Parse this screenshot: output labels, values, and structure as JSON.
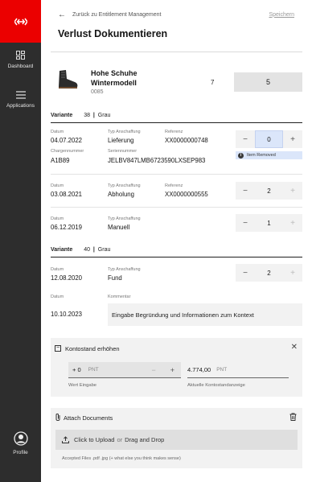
{
  "sidebar": {
    "items": [
      {
        "label": "Dashboard",
        "icon": "dashboard-icon"
      },
      {
        "label": "Applications",
        "icon": "menu-icon"
      },
      {
        "label": "Profile",
        "icon": "user-icon"
      }
    ]
  },
  "header": {
    "back_label": "Zurück zu Entitlement Management",
    "save_label": "Speichern",
    "title": "Verlust Dokumentieren"
  },
  "product": {
    "name": "Hohe Schuhe Wintermodell",
    "code": "0085",
    "quantity": "7",
    "loss_value": "5"
  },
  "variants": [
    {
      "label": "Variante",
      "size": "38",
      "color": "Grau",
      "entries": [
        {
          "datum_label": "Datum",
          "datum": "04.07.2022",
          "typ_label": "Typ Anschaffung",
          "typ": "Lieferung",
          "ref_label": "Referenz",
          "ref": "XX0000000748",
          "charge_label": "Chargennummer",
          "charge": "A1B89",
          "serial_label": "Seriennummer",
          "serial": "JELBV847LMB6723590LXSEP983",
          "value": "0",
          "note": "Item Removed",
          "note_icon": "i"
        },
        {
          "datum_label": "Datum",
          "datum": "03.08.2021",
          "typ_label": "Typ Anschaffung",
          "typ": "Abholung",
          "ref_label": "Referenz",
          "ref": "XX0000000555",
          "value": "2"
        },
        {
          "datum_label": "Datum",
          "datum": "06.12.2019",
          "typ_label": "Typ Anschaffung",
          "typ": "Manuell",
          "value": "1"
        }
      ]
    },
    {
      "label": "Variante",
      "size": "40",
      "color": "Grau",
      "entries": [
        {
          "datum_label": "Datum",
          "datum": "12.08.2020",
          "typ_label": "Typ Anschaffung",
          "typ": "Fund",
          "value": "2"
        }
      ]
    }
  ],
  "loss": {
    "datum_label": "Datum",
    "datum": "10.10.2023",
    "comment_label": "Kommentar",
    "comment_placeholder": "Eingabe Begründung und Informationen zum Kontext"
  },
  "kontostand": {
    "title": "Kontostand erhöhen",
    "toggle_symbol": "−",
    "input_sign": "+",
    "input_value": "0",
    "input_unit": "PNT",
    "input_label": "Wert Eingabe",
    "balance_value": "4.774,00",
    "balance_unit": "PNT",
    "balance_label": "Aktuelle Kontostandanzeige"
  },
  "attach": {
    "title": "Attach Documents",
    "upload_click": "Click to Upload",
    "upload_or": "or",
    "upload_drag": "Drag and Drop",
    "accepted": "Accepted Files .pdf .jpg (+ what else you think makes sense)"
  },
  "colors": {
    "brand": "#eb0000",
    "sidebar": "#2d2d2d",
    "highlight": "#dbe6fa"
  }
}
